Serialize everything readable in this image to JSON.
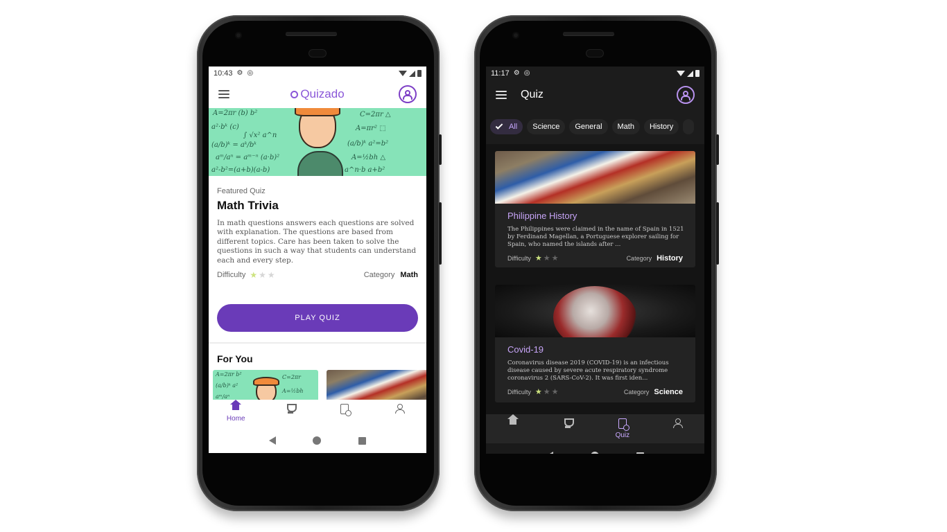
{
  "light_app": {
    "status": {
      "time": "10:43"
    },
    "brand": "Quizado",
    "featured": {
      "label": "Featured Quiz",
      "title": "Math Trivia",
      "description": "In math questions answers each questions are solved with explanation. The questions are based from different topics. Care has been taken to solve the questions in such a way that students can understand each and every step.",
      "difficulty_label": "Difficulty",
      "difficulty_rating": 1,
      "difficulty_max": 3,
      "category_label": "Category",
      "category_value": "Math",
      "play_button": "PLAY QUIZ"
    },
    "for_you_title": "For You",
    "nav": [
      {
        "icon": "home-icon",
        "label": "Home",
        "active": true
      },
      {
        "icon": "trophy-icon",
        "label": "",
        "active": false
      },
      {
        "icon": "quiz-doc-icon",
        "label": "",
        "active": false
      },
      {
        "icon": "person-icon",
        "label": "",
        "active": false
      }
    ],
    "accent": "#6a3bb8"
  },
  "dark_app": {
    "status": {
      "time": "11:17"
    },
    "title": "Quiz",
    "chips": [
      {
        "label": "All",
        "selected": true
      },
      {
        "label": "Science",
        "selected": false
      },
      {
        "label": "General",
        "selected": false
      },
      {
        "label": "Math",
        "selected": false
      },
      {
        "label": "History",
        "selected": false
      }
    ],
    "cards": [
      {
        "title": "Philippine History",
        "description": "The Philippines were claimed in the name of Spain in 1521 by Ferdinand Magellan, a Portuguese explorer sailing for Spain, who named the islands after ...",
        "difficulty_label": "Difficulty",
        "difficulty_rating": 1,
        "difficulty_max": 3,
        "category_label": "Category",
        "category_value": "History"
      },
      {
        "title": "Covid-19",
        "description": "Coronavirus disease 2019 (COVID-19) is an infectious disease caused by severe acute respiratory syndrome coronavirus 2 (SARS-CoV-2). It was first iden...",
        "difficulty_label": "Difficulty",
        "difficulty_rating": 1,
        "difficulty_max": 3,
        "category_label": "Category",
        "category_value": "Science"
      }
    ],
    "nav": [
      {
        "icon": "home-icon",
        "label": "",
        "active": false
      },
      {
        "icon": "trophy-icon",
        "label": "",
        "active": false
      },
      {
        "icon": "quiz-doc-icon",
        "label": "Quiz",
        "active": true
      },
      {
        "icon": "person-icon",
        "label": "",
        "active": false
      }
    ],
    "accent": "#c9a9ff"
  }
}
